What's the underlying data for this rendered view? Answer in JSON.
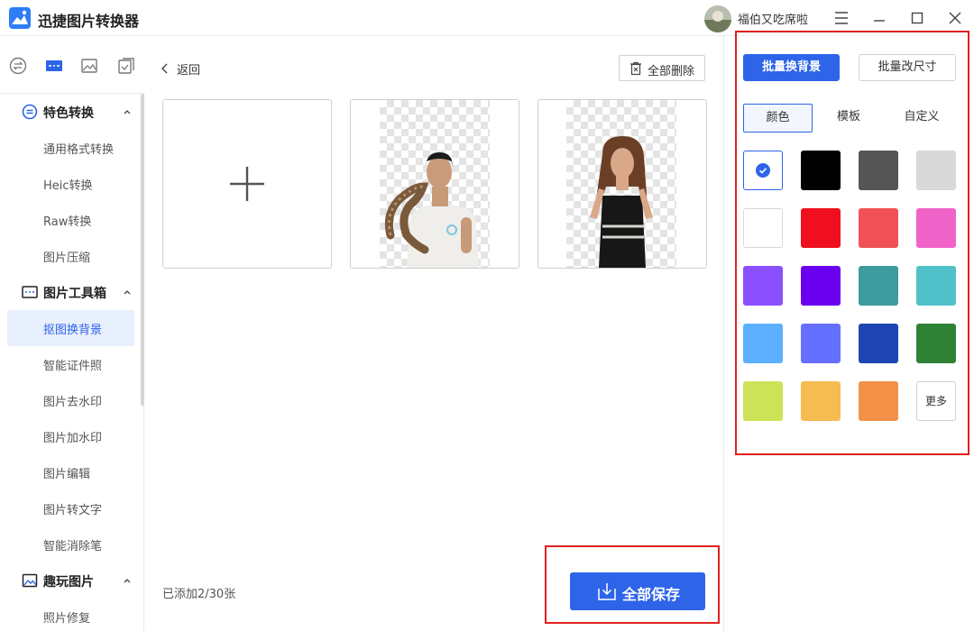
{
  "app": {
    "title": "迅捷图片转换器",
    "username": "福伯又吃席啦"
  },
  "sidebar": {
    "sections": [
      {
        "label": "特色转换",
        "items": [
          "通用格式转换",
          "Heic转换",
          "Raw转换",
          "图片压缩"
        ]
      },
      {
        "label": "图片工具箱",
        "items": [
          "抠图换背景",
          "智能证件照",
          "图片去水印",
          "图片加水印",
          "图片编辑",
          "图片转文字",
          "智能消除笔"
        ]
      },
      {
        "label": "趣玩图片",
        "items": [
          "照片修复"
        ]
      }
    ],
    "active_item": "抠图换背景"
  },
  "main": {
    "back_label": "返回",
    "delete_all_label": "全部删除",
    "added_count": "已添加2/30张",
    "save_all_label": "全部保存"
  },
  "panel": {
    "mode_buttons": [
      "批量换背景",
      "批量改尺寸"
    ],
    "tabs": [
      "颜色",
      "模板",
      "自定义"
    ],
    "colors": [
      "#000000",
      "#555555",
      "#d9d9d9",
      "#ffffff",
      "#f00f1f",
      "#f05157",
      "#f063c8",
      "#8a50ff",
      "#6a00f0",
      "#3e9b9e",
      "#51c1c9",
      "#5db0ff",
      "#6670ff",
      "#1f45b3",
      "#2e8235",
      "#cde357",
      "#f5bc52",
      "#f39148"
    ],
    "more_label": "更多"
  }
}
